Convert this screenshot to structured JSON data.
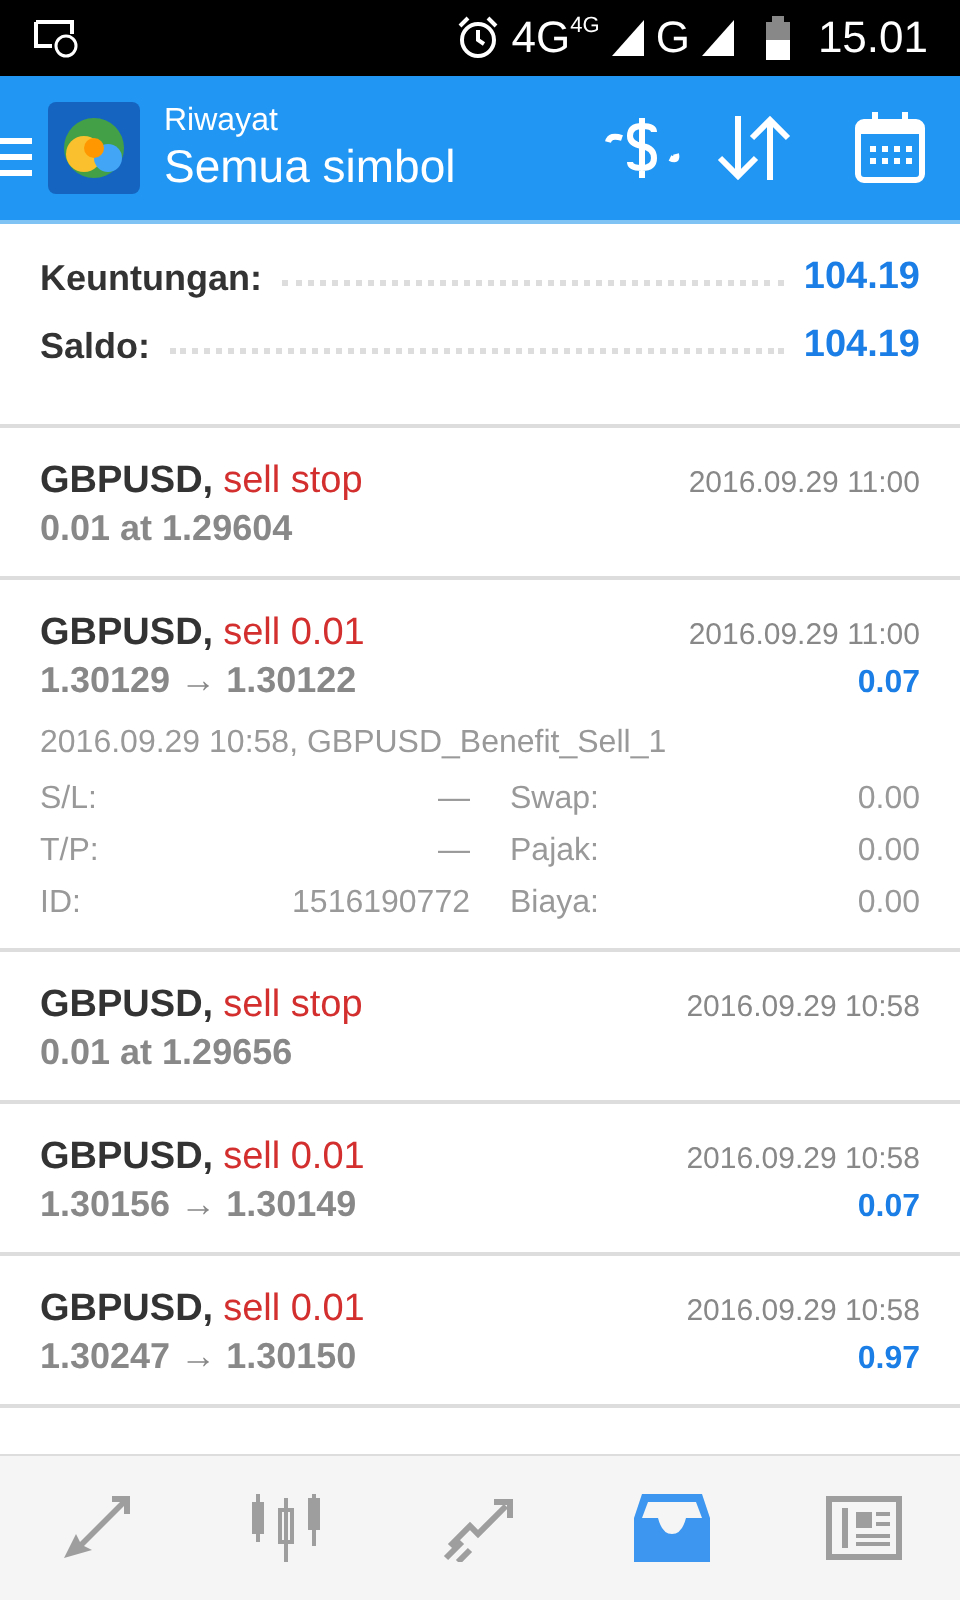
{
  "status_bar": {
    "network": "4G",
    "network_small": "4G",
    "network2": "G",
    "time": "15.01"
  },
  "header": {
    "title": "Riwayat",
    "subtitle": "Semua simbol"
  },
  "summary": [
    {
      "label": "Keuntungan:",
      "value": "104.19"
    },
    {
      "label": "Saldo:",
      "value": "104.19"
    }
  ],
  "deals": [
    {
      "symbol": "GBPUSD,",
      "action": "sell stop",
      "time": "2016.09.29 11:00",
      "line": "0.01 at 1.29604"
    },
    {
      "symbol": "GBPUSD,",
      "action": "sell 0.01",
      "time": "2016.09.29 11:00",
      "line": "1.30129 → 1.30122",
      "profit": "0.07",
      "details": {
        "open": "2016.09.29 10:58, GBPUSD_Benefit_Sell_1",
        "fields": [
          {
            "label": "S/L:",
            "value": "—",
            "label2": "Swap:",
            "value2": "0.00"
          },
          {
            "label": "T/P:",
            "value": "—",
            "label2": "Pajak:",
            "value2": "0.00"
          },
          {
            "label": "ID:",
            "value": "1516190772",
            "label2": "Biaya:",
            "value2": "0.00"
          }
        ]
      }
    },
    {
      "symbol": "GBPUSD,",
      "action": "sell stop",
      "time": "2016.09.29 10:58",
      "line": "0.01 at 1.29656"
    },
    {
      "symbol": "GBPUSD,",
      "action": "sell 0.01",
      "time": "2016.09.29 10:58",
      "line": "1.30156 → 1.30149",
      "profit": "0.07"
    },
    {
      "symbol": "GBPUSD,",
      "action": "sell 0.01",
      "time": "2016.09.29 10:58",
      "line": "1.30247 → 1.30150",
      "profit": "0.97"
    }
  ],
  "bottom_nav": [
    {
      "kind": "quotes",
      "selected": false
    },
    {
      "kind": "chart",
      "selected": false
    },
    {
      "kind": "trade",
      "selected": false
    },
    {
      "kind": "history",
      "selected": true
    },
    {
      "kind": "news",
      "selected": false
    }
  ]
}
